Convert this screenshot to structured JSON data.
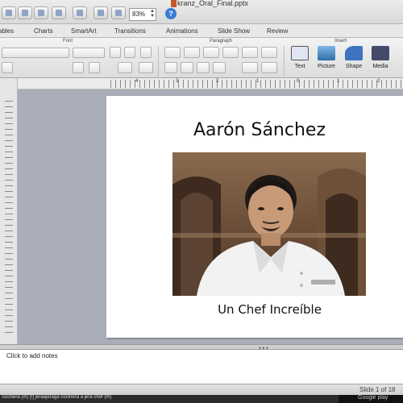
{
  "toolbar": {
    "zoom_value": "83%",
    "help_label": "?",
    "document_title": "kranz_Oral_Final.pptx"
  },
  "tabs": [
    "Tables",
    "Charts",
    "SmartArt",
    "Transitions",
    "Animations",
    "Slide Show",
    "Review"
  ],
  "ribbon": {
    "groups": {
      "font": "Font",
      "paragraph": "Paragraph",
      "insert": "Insert"
    },
    "insert_buttons": [
      {
        "label": "Text",
        "icon": "text-box-icon",
        "color": "#dfe6f2"
      },
      {
        "label": "Picture",
        "icon": "picture-icon",
        "color": "#3f86c6"
      },
      {
        "label": "Shape",
        "icon": "shape-icon",
        "color": "#3f74c0"
      },
      {
        "label": "Media",
        "icon": "media-icon",
        "color": "#444a6a"
      }
    ]
  },
  "ruler": {
    "marks": [
      "4",
      "3",
      "2",
      "1",
      "0",
      "1",
      "2"
    ]
  },
  "slide": {
    "title": "Aarón Sánchez",
    "subtitle": "Un Chef Increíble"
  },
  "notes": {
    "placeholder": "Click to add notes"
  },
  "status": {
    "slide_position": "Slide 1 of 18"
  },
  "background_window": {
    "caption": "cocinera (m) [f] jeraajeraga cocinera a jera chef (m)",
    "badge": "Google play"
  },
  "colors": {
    "canvas": "#a9aeb8",
    "ribbon": "#e5e5e5",
    "accent": "#3a7bd5"
  }
}
